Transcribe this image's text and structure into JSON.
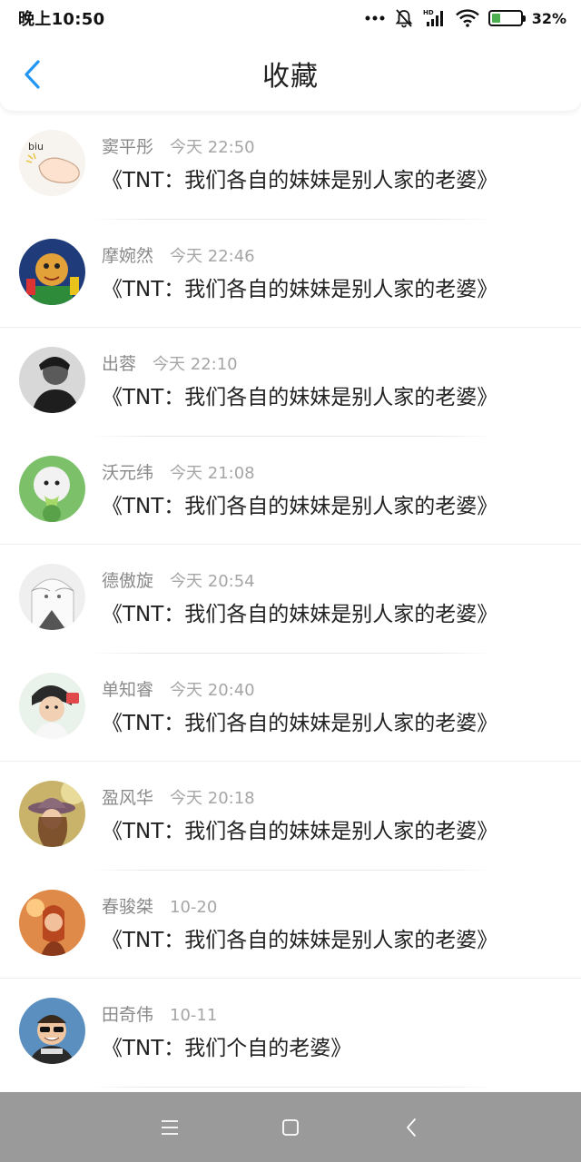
{
  "status_bar": {
    "time": "晚上10:50",
    "battery_pct": "32%",
    "battery_level": 0.32,
    "hd_label": "HD",
    "icons": [
      "dots-icon",
      "bell-muted-icon",
      "signal-icon",
      "wifi-icon",
      "battery-icon"
    ]
  },
  "header": {
    "title": "收藏",
    "back_icon": "chevron-left-icon",
    "accent_color": "#2196F3"
  },
  "items": [
    {
      "name": "窦平彤",
      "time": "今天 22:50",
      "text": "《TNT：我们各自的妹妹是别人家的老婆》",
      "avatar": "avatar-biu-hand"
    },
    {
      "name": "摩婉然",
      "time": "今天 22:46",
      "text": "《TNT：我们各自的妹妹是别人家的老婆》",
      "avatar": "avatar-puppet"
    },
    {
      "name": "出蓉",
      "time": "今天 22:10",
      "text": "《TNT：我们各自的妹妹是别人家的老婆》",
      "avatar": "avatar-man-bw"
    },
    {
      "name": "沃元纬",
      "time": "今天 21:08",
      "text": "《TNT：我们各自的妹妹是别人家的老婆》",
      "avatar": "avatar-green-toy"
    },
    {
      "name": "德傲旋",
      "time": "今天 20:54",
      "text": "《TNT：我们各自的妹妹是别人家的老婆》",
      "avatar": "avatar-anime"
    },
    {
      "name": "单知睿",
      "time": "今天 20:40",
      "text": "《TNT：我们各自的妹妹是别人家的老婆》",
      "avatar": "avatar-boy"
    },
    {
      "name": "盈风华",
      "time": "今天 20:18",
      "text": "《TNT：我们各自的妹妹是别人家的老婆》",
      "avatar": "avatar-hat-girl"
    },
    {
      "name": "春骏桀",
      "time": "10-20",
      "text": "《TNT：我们各自的妹妹是别人家的老婆》",
      "avatar": "avatar-sunset-girl"
    },
    {
      "name": "田奇伟",
      "time": "10-11",
      "text": "《TNT：我们个自的老婆》",
      "avatar": "avatar-sunglasses-man"
    }
  ],
  "nav_bar": {
    "buttons": [
      "menu-icon",
      "home-square-icon",
      "back-chevron-icon"
    ],
    "color": "#9a9a9a"
  }
}
